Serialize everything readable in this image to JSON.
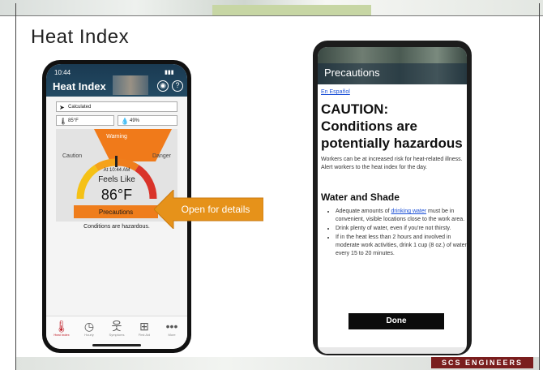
{
  "slide": {
    "title": "Heat Index",
    "callout_text": "Open for details",
    "footer_logo": "SCS ENGINEERS",
    "colors": {
      "accent_orange": "#ef7d1c",
      "callout_orange": "#e6921a",
      "logo": "#7a1e1e"
    }
  },
  "phone_left": {
    "status_time": "10:44",
    "header_title": "Heat Index",
    "location_field": "Calculated",
    "temperature_field": "85°F",
    "humidity_field": "49%",
    "gauge": {
      "warning_label": "Warning",
      "caution_label": "Caution",
      "danger_label": "Danger",
      "time_text": "At 10:44 AM",
      "feels_like_label": "Feels Like",
      "temperature": "86°F"
    },
    "precautions_button": "Precautions",
    "status_text": "Conditions are hazardous.",
    "tabs": [
      {
        "label": "Heat Index",
        "icon": "thermometer-icon"
      },
      {
        "label": "Hourly",
        "icon": "clock-icon"
      },
      {
        "label": "Symptoms",
        "icon": "person-icon"
      },
      {
        "label": "First Aid",
        "icon": "first-aid-icon"
      },
      {
        "label": "More",
        "icon": "more-icon"
      }
    ]
  },
  "phone_right": {
    "header_title": "Precautions",
    "spanish_link": "En Español",
    "heading": "CAUTION: Conditions are potentially hazardous",
    "paragraph": "Workers can be at increased risk for heat-related illness. Alert workers to the heat index for the day.",
    "subheading": "Water and Shade",
    "list": {
      "item1_prefix": "Adequate amounts of ",
      "item1_link": "drinking water",
      "item1_suffix": " must be in convenient, visible locations close to the work area.",
      "item2": "Drink plenty of water, even if you're not thirsty.",
      "item3": "If in the heat less than 2 hours and involved in moderate work activities, drink 1 cup (8 oz.) of water every 15 to 20 minutes."
    },
    "done_button": "Done"
  }
}
